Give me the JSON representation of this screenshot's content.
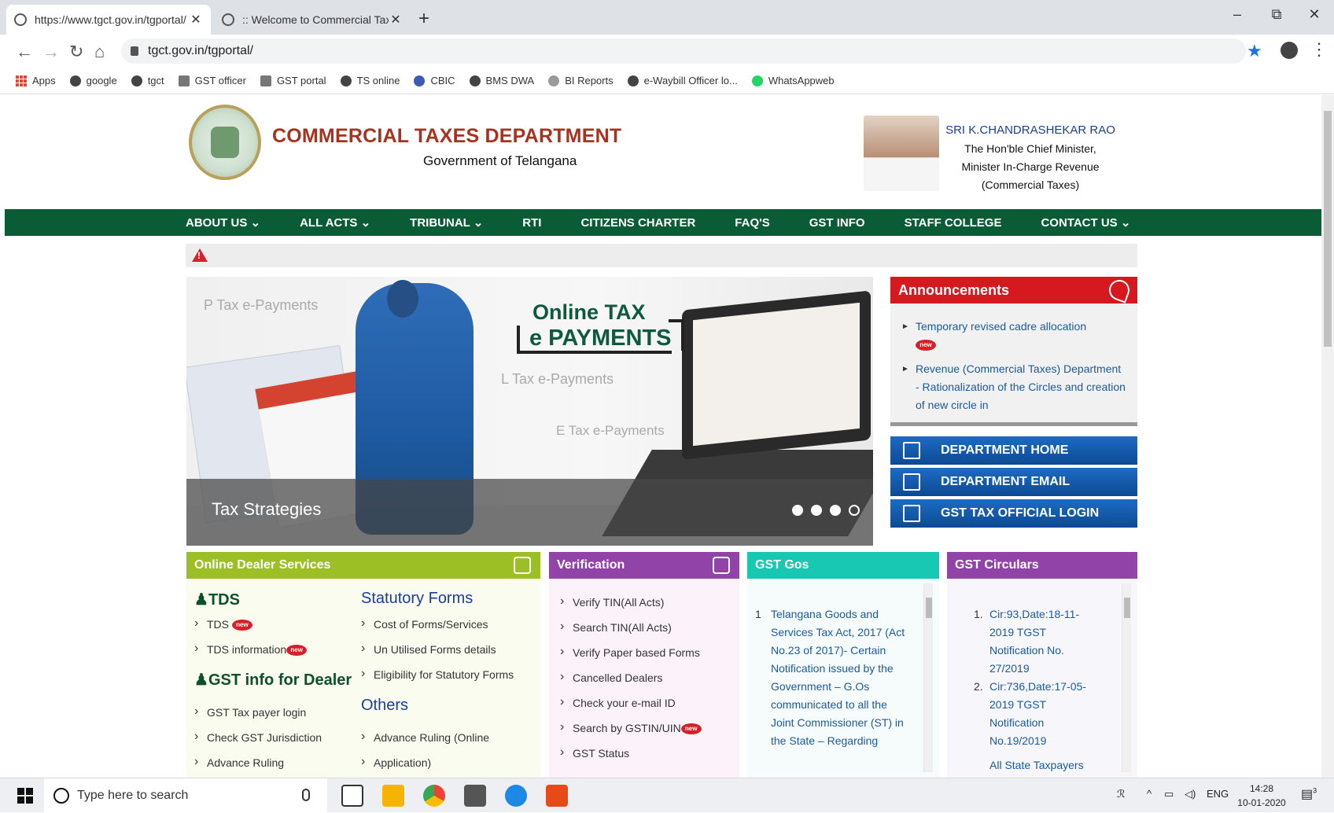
{
  "browser": {
    "tabs": [
      {
        "title": "https://www.tgct.gov.in/tgportal/",
        "active": true
      },
      {
        "title": ":: Welcome to Commercial Taxes",
        "active": false
      }
    ],
    "new_tab": "+",
    "window_controls": {
      "minimize": "–",
      "restore": "⧉",
      "close": "✕"
    },
    "address": "tgct.gov.in/tgportal/",
    "bookmarks": [
      {
        "label": "Apps",
        "icon": "apps-grid-icon"
      },
      {
        "label": "google",
        "icon": "globe-icon"
      },
      {
        "label": "tgct",
        "icon": "globe-icon"
      },
      {
        "label": "GST officer",
        "icon": "building-icon"
      },
      {
        "label": "GST portal",
        "icon": "building-icon"
      },
      {
        "label": "TS online",
        "icon": "globe-icon"
      },
      {
        "label": "CBIC",
        "icon": "cbic-icon"
      },
      {
        "label": "BMS DWA",
        "icon": "globe-icon"
      },
      {
        "label": "BI Reports",
        "icon": "dots-icon"
      },
      {
        "label": "e-Waybill Officer lo...",
        "icon": "globe-icon"
      },
      {
        "label": "WhatsAppweb",
        "icon": "whatsapp-icon"
      }
    ]
  },
  "header": {
    "title": "COMMERCIAL TAXES DEPARTMENT",
    "subtitle": "Government of Telangana",
    "cm_name": "SRI K.CHANDRASHEKAR RAO",
    "cm_line1": "The Hon'ble Chief Minister,",
    "cm_line2": "Minister In-Charge Revenue",
    "cm_line3": "(Commercial Taxes)"
  },
  "nav": [
    "ABOUT US ⌄",
    "ALL ACTS ⌄",
    "TRIBUNAL ⌄",
    "RTI",
    "CITIZENS CHARTER",
    "FAQ'S",
    "GST INFO",
    "STAFF COLLEGE",
    "CONTACT US ⌄"
  ],
  "slider": {
    "text1": "P Tax e-Payments",
    "text2": "L Tax e-Payments",
    "text3": "E Tax e-Payments",
    "headline1": "Online TAX",
    "headline2": "e PAYMENTS",
    "caption": "Tax Strategies"
  },
  "announcements": {
    "title": "Announcements",
    "items": [
      "Temporary revised cadre allocation",
      "Revenue (Commercial Taxes) Department - Rationalization of the Circles and creation of new circle in"
    ],
    "new_badge": "new"
  },
  "quick_links": [
    "DEPARTMENT HOME",
    "DEPARTMENT EMAIL",
    "GST TAX OFFICIAL LOGIN"
  ],
  "online_dealer": {
    "title": "Online Dealer Services",
    "tds_heading": "TDS",
    "tds_items": [
      "TDS",
      "TDS information"
    ],
    "gst_heading": "GST info for Dealer",
    "gst_items": [
      "GST Tax payer login",
      "Check GST Jurisdiction",
      "Advance Ruling"
    ],
    "forms_heading": "Statutory Forms",
    "forms_items": [
      "Cost of Forms/Services",
      "Un Utilised Forms details",
      "Eligibility for Statutory Forms"
    ],
    "others_heading": "Others",
    "others_items": [
      "Advance Ruling (Online",
      "Application)"
    ]
  },
  "verification": {
    "title": "Verification",
    "items": [
      "Verify TIN(All Acts)",
      "Search TIN(All Acts)",
      "Verify Paper based Forms",
      "Cancelled Dealers",
      "Check your e-mail ID",
      "Search by GSTIN/UIN",
      "GST Status"
    ]
  },
  "gst_gos": {
    "title": "GST Gos",
    "num": "1",
    "text": "Telangana Goods and Services Tax Act, 2017 (Act No.23 of 2017)- Certain Notification issued by the Government – G.Os communicated to all the Joint Commissioner (ST) in the State – Regarding"
  },
  "gst_circulars": {
    "title": "GST Circulars",
    "items": [
      {
        "num": "1.",
        "text": "Cir:93,Date:18-11-2019 TGST Notification No. 27/2019"
      },
      {
        "num": "2.",
        "text": "Cir:736,Date:17-05-2019 TGST Notification No.19/2019"
      }
    ],
    "tail": "All State Taxpayers"
  },
  "taskbar": {
    "search_placeholder": "Type here to search",
    "lang": "ENG",
    "time": "14:28",
    "date": "10-01-2020",
    "notif_count": "3"
  }
}
